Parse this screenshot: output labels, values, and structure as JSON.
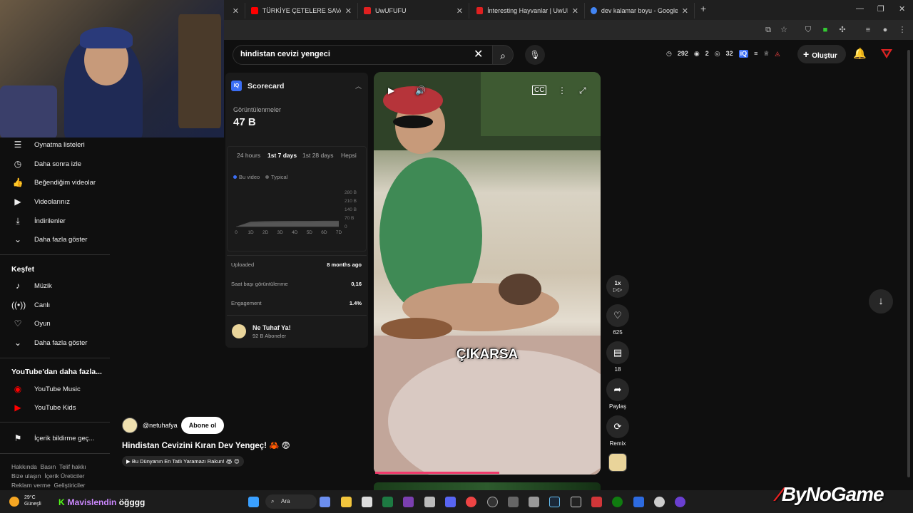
{
  "browser": {
    "tabs": [
      {
        "label": "TÜRKİYE ÇETELERE SAVAŞ AÇTI",
        "color": "#ff0000"
      },
      {
        "label": "UwUFUFU",
        "color": "#e02020"
      },
      {
        "label": "İnteresting Hayvanlar | UwUFU",
        "color": "#e02020"
      },
      {
        "label": "dev kalamar boyu - Google'da",
        "color": "#4285f4"
      }
    ],
    "new_tab": "+"
  },
  "search": {
    "query": "hindistan cevizi yengeci"
  },
  "top_stats": {
    "time": "292",
    "likes": "2",
    "views": "32"
  },
  "header": {
    "create_label": "Oluştur"
  },
  "sidebar": {
    "you_items": [
      {
        "label": "Oynatma listeleri",
        "icon": "playlist-icon"
      },
      {
        "label": "Daha sonra izle",
        "icon": "clock-icon"
      },
      {
        "label": "Beğendiğim videolar",
        "icon": "thumbs-up-icon"
      },
      {
        "label": "Videolarınız",
        "icon": "play-icon"
      },
      {
        "label": "İndirilenler",
        "icon": "download-icon"
      },
      {
        "label": "Daha fazla göster",
        "icon": "chevron-down-icon"
      }
    ],
    "explore_title": "Keşfet",
    "explore_items": [
      {
        "label": "Müzik",
        "icon": "music-note-icon"
      },
      {
        "label": "Canlı",
        "icon": "live-icon"
      },
      {
        "label": "Oyun",
        "icon": "gamepad-icon"
      },
      {
        "label": "Daha fazla göster",
        "icon": "chevron-down-icon"
      }
    ],
    "more_title": "YouTube'dan daha fazla...",
    "more_items": [
      {
        "label": "YouTube Music",
        "icon": "youtube-music-icon"
      },
      {
        "label": "YouTube Kids",
        "icon": "youtube-kids-icon"
      }
    ],
    "feedback": "İçerik bildirme geç...",
    "footer_line1": "Hakkında  Basın  Telif hakkı",
    "footer_line2": "Bize ulaşın  İçerik Üreticiler",
    "footer_line3": "Reklam verme  Geliştiriciler"
  },
  "scorecard": {
    "title": "Scorecard",
    "views_label": "Görüntülenmeler",
    "views_value": "47 B",
    "tabs": [
      "24 hours",
      "1st 7 days",
      "1st 28 days",
      "Hepsi"
    ],
    "active_tab": "1st 7 days",
    "legend": [
      "Bu video",
      "Typical"
    ],
    "chart_data": {
      "type": "area",
      "x": [
        "0",
        "1D",
        "2D",
        "3D",
        "4D",
        "5D",
        "6D",
        "7D"
      ],
      "y_ticks": [
        "280 B",
        "210 B",
        "140 B",
        "70 B",
        "0"
      ],
      "series": [
        {
          "name": "Typical",
          "values": [
            0,
            25,
            30,
            32,
            33,
            34,
            35,
            36
          ]
        },
        {
          "name": "Bu video",
          "values": [
            0,
            40,
            44,
            45,
            46,
            46,
            47,
            47
          ]
        }
      ],
      "ylim": [
        0,
        280
      ]
    },
    "uploaded_label": "Uploaded",
    "uploaded_value": "8 months ago",
    "vph_label": "Saat başı görüntülenme",
    "vph_value": "0,16",
    "engagement_label": "Engagement",
    "engagement_value": "1.4%",
    "channel_name": "Ne Tuhaf Ya!",
    "channel_subs": "92 B Aboneler",
    "colors": {
      "accent": "#3b6ef5"
    }
  },
  "video": {
    "caption": "ÇIKARSA",
    "progress": 0.55,
    "speed": "1x",
    "likes": "625",
    "comments": "18",
    "share_label": "Paylaş",
    "remix_label": "Remix",
    "uploader": "@netuhafya",
    "subscribe_label": "Abone ol",
    "title": "Hindistan Cevizini Kıran Dev Yengeç! 🦀 😨",
    "music": "▶ Bu Dünyanın En Tatlı Yaramazı Rakun! 🦝 😊"
  },
  "taskbar": {
    "temp": "29°C",
    "weather": "Güneşli",
    "search_label": "Ara",
    "streamer": "Mavislendin",
    "streamer_suffix": "öğggg"
  },
  "watermark": "ByNoGame"
}
